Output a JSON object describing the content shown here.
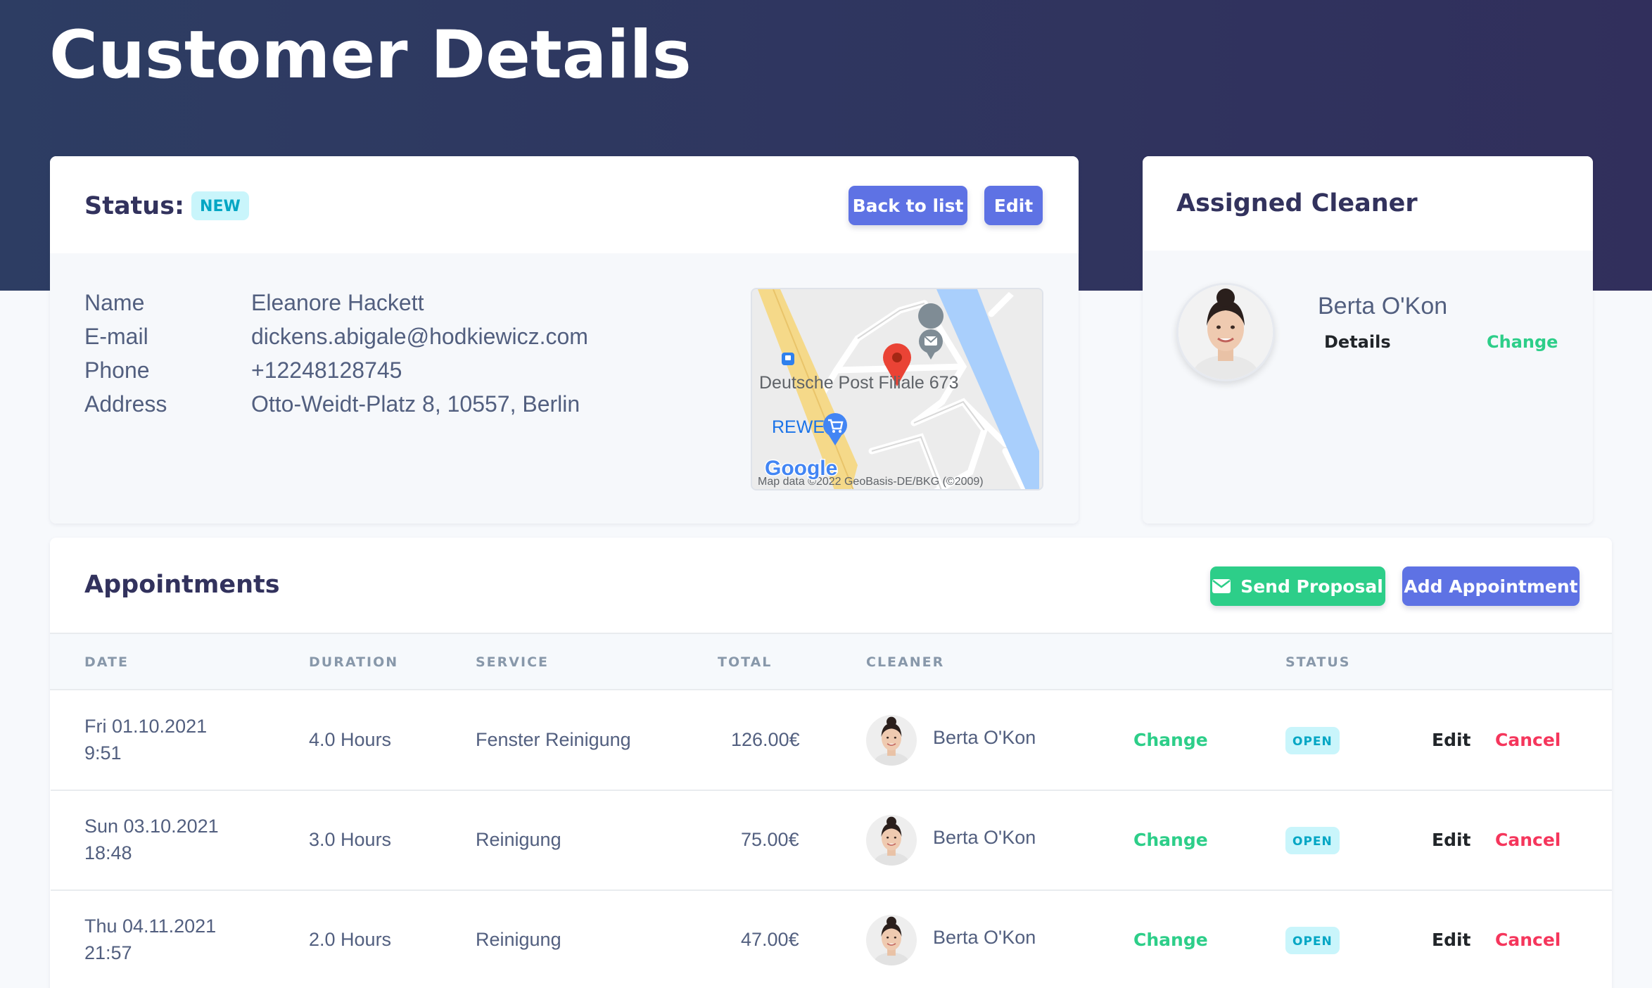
{
  "page": {
    "title": "Customer Details"
  },
  "customer_card": {
    "status_label": "Status:",
    "status_badge": "NEW",
    "back_button": "Back to list",
    "edit_button": "Edit",
    "fields": [
      {
        "label": "Name",
        "value": "Eleanore Hackett"
      },
      {
        "label": "E-mail",
        "value": "dickens.abigale@hodkiewicz.com"
      },
      {
        "label": "Phone",
        "value": "+12248128745"
      },
      {
        "label": "Address",
        "value": "Otto-Weidt-Platz 8, 10557, Berlin"
      }
    ],
    "map": {
      "poi_post": "Deutsche Post Filiale 673",
      "poi_rewe": "REWE",
      "logo": "Google",
      "attribution": "Map data ©2022 GeoBasis-DE/BKG (©2009)"
    }
  },
  "assigned_cleaner": {
    "title": "Assigned Cleaner",
    "name": "Berta O'Kon",
    "details_link": "Details",
    "change_link": "Change"
  },
  "appointments": {
    "title": "Appointments",
    "send_proposal_button": "Send Proposal",
    "add_appointment_button": "Add Appointment",
    "columns": [
      "Date",
      "Duration",
      "Service",
      "Total",
      "Cleaner",
      "Status"
    ],
    "rows": [
      {
        "date": "Fri 01.10.2021",
        "time": "9:51",
        "duration": "4.0 Hours",
        "service": "Fenster Reinigung",
        "total": "126.00€",
        "cleaner": "Berta O'Kon",
        "change": "Change",
        "status": "OPEN",
        "edit": "Edit",
        "cancel": "Cancel"
      },
      {
        "date": "Sun 03.10.2021",
        "time": "18:48",
        "duration": "3.0 Hours",
        "service": "Reinigung",
        "total": "75.00€",
        "cleaner": "Berta O'Kon",
        "change": "Change",
        "status": "OPEN",
        "edit": "Edit",
        "cancel": "Cancel"
      },
      {
        "date": "Thu 04.11.2021",
        "time": "21:57",
        "duration": "2.0 Hours",
        "service": "Reinigung",
        "total": "47.00€",
        "cleaner": "Berta O'Kon",
        "change": "Change",
        "status": "OPEN",
        "edit": "Edit",
        "cancel": "Cancel"
      }
    ]
  },
  "colors": {
    "primary": "#5e72e4",
    "success": "#2dce89",
    "danger": "#f5365c",
    "info": "#11cdef",
    "hero": "#2d3d63"
  },
  "icons": [
    "envelope-icon",
    "map-pin-icon",
    "mail-pin-icon",
    "shopping-cart-icon",
    "bus-stop-icon"
  ]
}
